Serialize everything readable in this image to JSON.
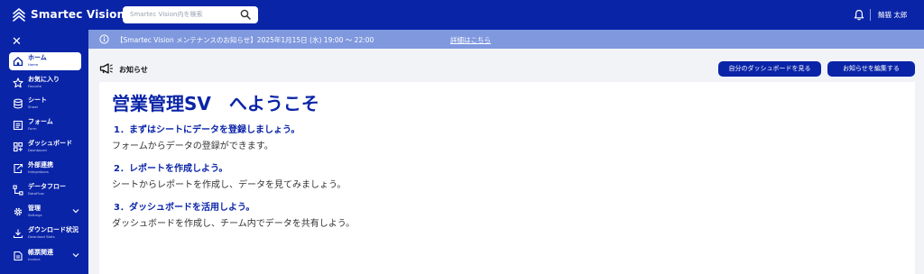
{
  "header": {
    "brand": "Smartec Vision",
    "search_placeholder": "Smartec Vision内を検索",
    "user_name": "鯖猫 太郎"
  },
  "sidebar": {
    "items": [
      {
        "label": "ホーム",
        "sub": "Home",
        "icon": "home-icon",
        "active": true
      },
      {
        "label": "お気に入り",
        "sub": "Favorite",
        "icon": "star-icon"
      },
      {
        "label": "シート",
        "sub": "Sheet",
        "icon": "database-icon"
      },
      {
        "label": "フォーム",
        "sub": "Form",
        "icon": "form-icon"
      },
      {
        "label": "ダッシュボード",
        "sub": "Dashboard",
        "icon": "dashboard-icon"
      },
      {
        "label": "外部連携",
        "sub": "Integrations",
        "icon": "integration-icon"
      },
      {
        "label": "データフロー",
        "sub": "DataFlow",
        "icon": "dataflow-icon"
      },
      {
        "label": "管理",
        "sub": "Settings",
        "icon": "gear-icon",
        "expandable": true
      },
      {
        "label": "ダウンロード状況",
        "sub": "Download Stats",
        "icon": "download-icon"
      },
      {
        "label": "帳票関連",
        "sub": "Invoice",
        "icon": "document-icon",
        "expandable": true
      }
    ]
  },
  "banner": {
    "text": "【Smartec Vision メンテナンスのお知らせ】2025年1月15日 (水) 19:00 ～ 22:00",
    "link": "詳細はこちら"
  },
  "section": {
    "title": "お知らせ",
    "dashboard_button": "自分のダッシュボードを見る",
    "edit_button": "お知らせを編集する"
  },
  "content": {
    "welcome": "営業管理SV　へようこそ",
    "steps": [
      {
        "heading": "1．まずはシートにデータを登録しましょう。",
        "desc": "フォームからデータの登録ができます。"
      },
      {
        "heading": "2．レポートを作成しよう。",
        "desc": "シートからレポートを作成し、データを見てみましょう。"
      },
      {
        "heading": "3．ダッシュボードを活用しよう。",
        "desc": "ダッシュボードを作成し、チーム内でデータを共有しよう。"
      }
    ]
  },
  "colors": {
    "brand_blue": "#0a24a8",
    "banner_blue": "#7f98de",
    "background": "#f2f3f7"
  }
}
